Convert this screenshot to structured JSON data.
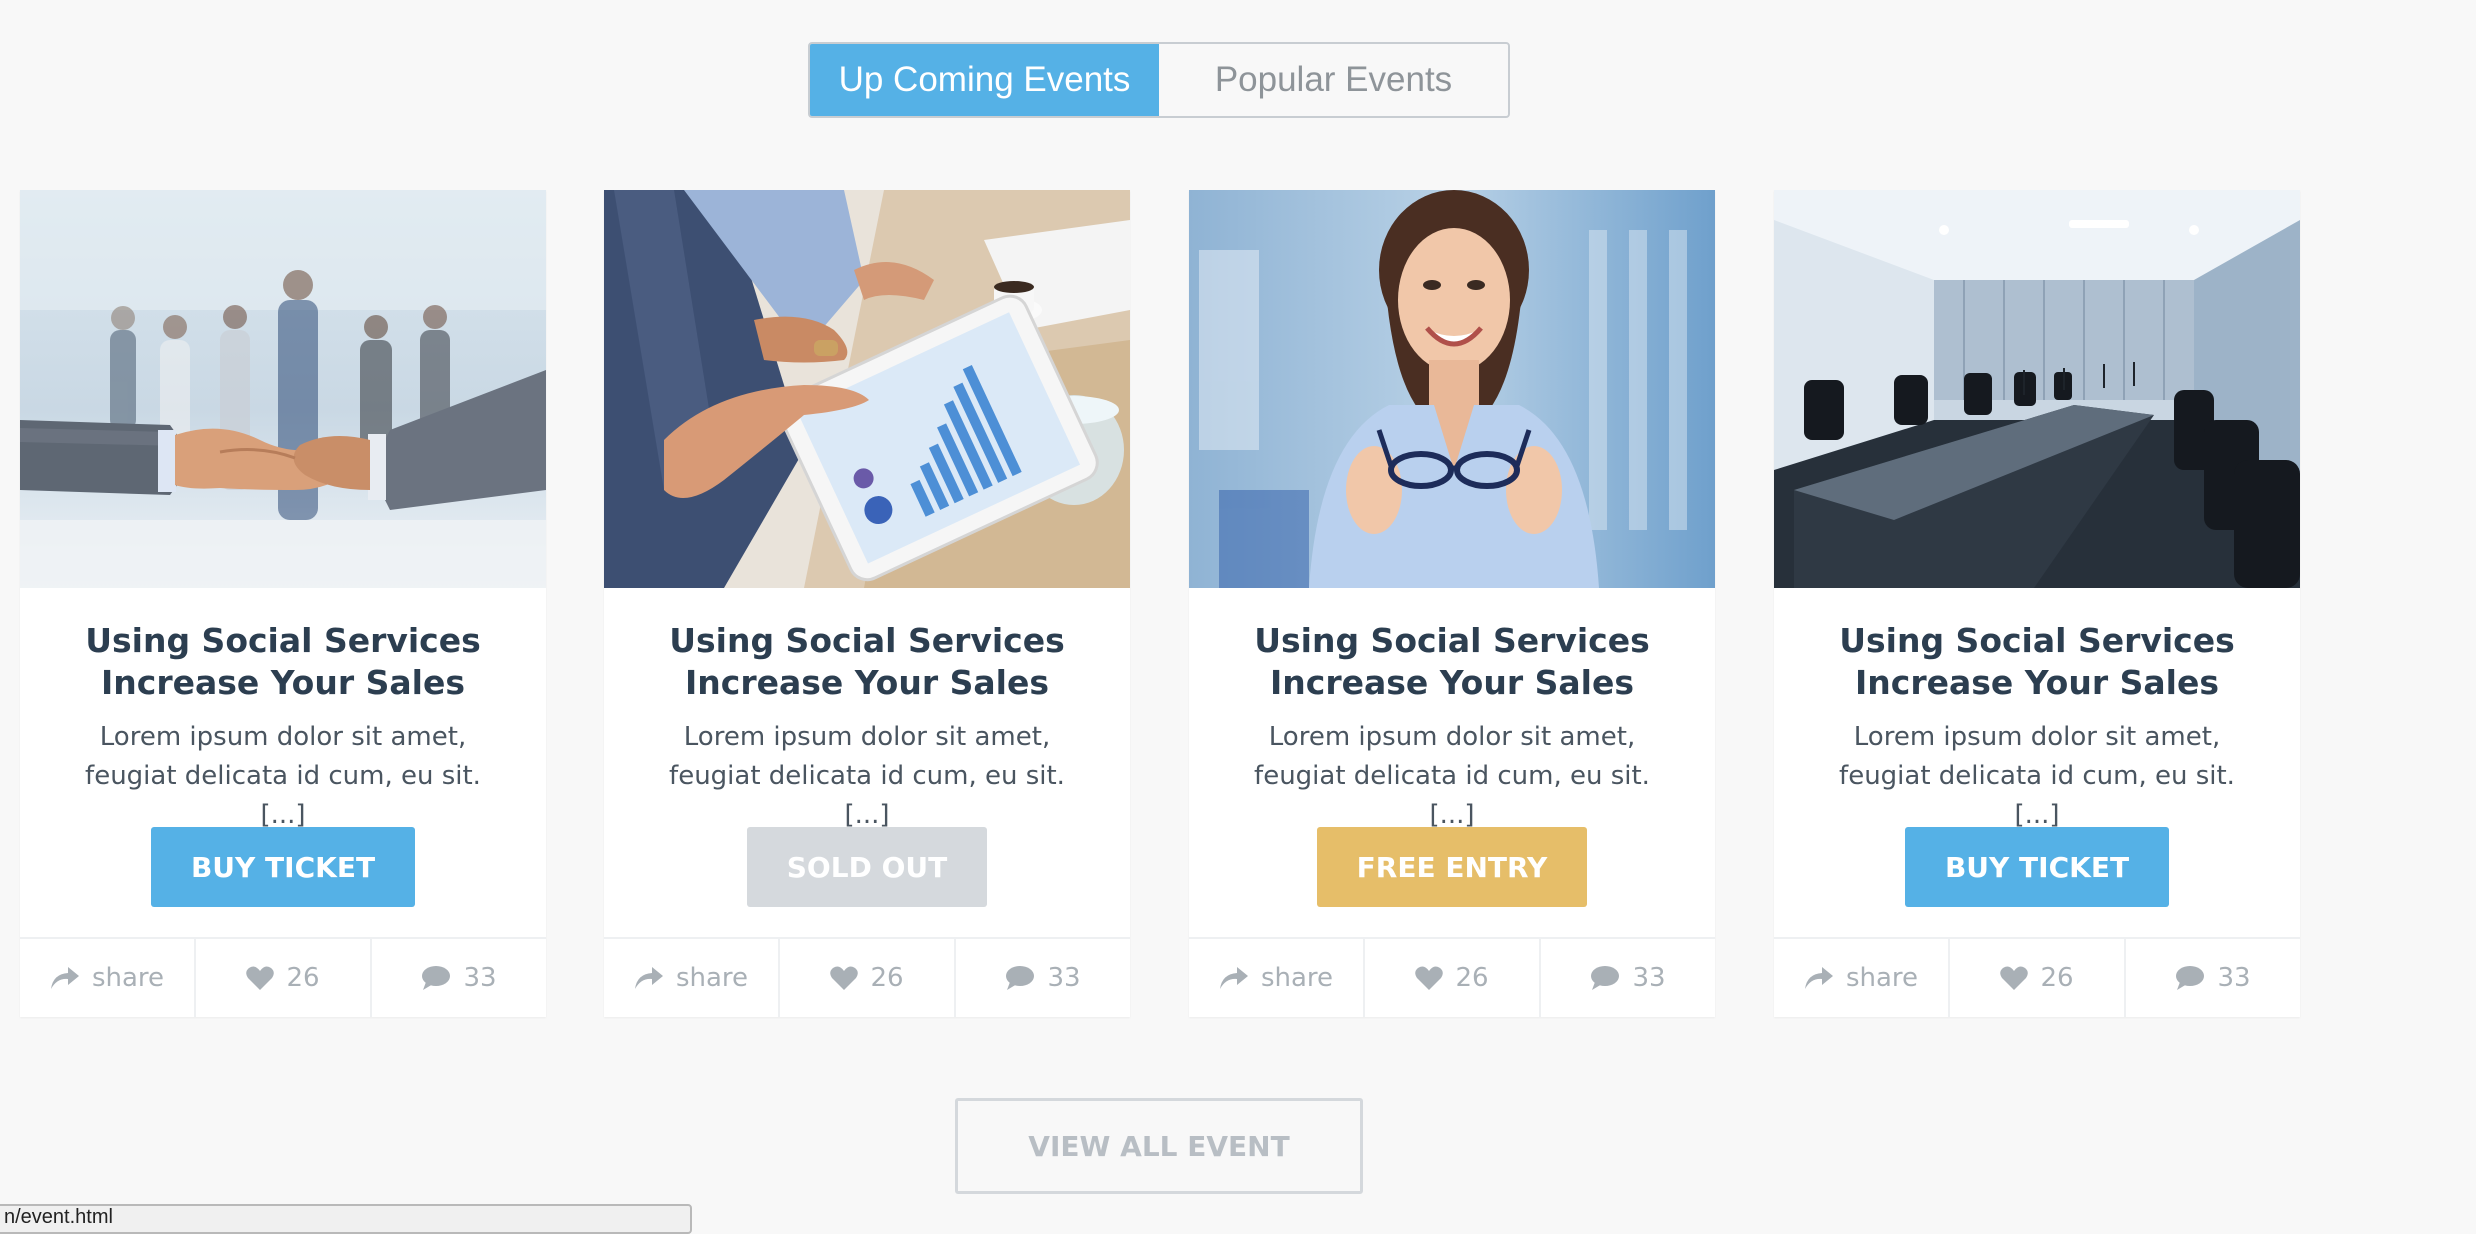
{
  "tabs": [
    {
      "label": "Up Coming Events",
      "active": true
    },
    {
      "label": "Popular Events",
      "active": false
    }
  ],
  "events": [
    {
      "image": "handshake-photo",
      "title": "Using Social Services Increase Your Sales",
      "description": "Lorem ipsum dolor sit amet, feugiat delicata id cum, eu sit. [...]",
      "button_label": "BUY TICKET",
      "button_color": "#55b1e6",
      "share_label": "share",
      "likes": "26",
      "comments": "33"
    },
    {
      "image": "tablet-chart-photo",
      "title": "Using Social Services Increase Your Sales",
      "description": "Lorem ipsum dolor sit amet, feugiat delicata id cum, eu sit. [...]",
      "button_label": "SOLD OUT",
      "button_color": "#d5d9dd",
      "share_label": "share",
      "likes": "26",
      "comments": "33"
    },
    {
      "image": "woman-glasses-photo",
      "title": "Using Social Services Increase Your Sales",
      "description": "Lorem ipsum dolor sit amet, feugiat delicata id cum, eu sit. [...]",
      "button_label": "FREE ENTRY",
      "button_color": "#e6be69",
      "share_label": "share",
      "likes": "26",
      "comments": "33"
    },
    {
      "image": "conference-room-photo",
      "title": "Using Social Services Increase Your Sales",
      "description": "Lorem ipsum dolor sit amet, feugiat delicata id cum, eu sit. [...]",
      "button_label": "BUY TICKET",
      "button_color": "#55b1e6",
      "share_label": "share",
      "likes": "26",
      "comments": "33"
    }
  ],
  "view_all_label": "VIEW ALL EVENT",
  "status_url": "n/event.html",
  "colors": {
    "accent": "#55b1e6",
    "title": "#2c3e50",
    "muted": "#a9b0b6",
    "background": "#f8f8f8"
  }
}
